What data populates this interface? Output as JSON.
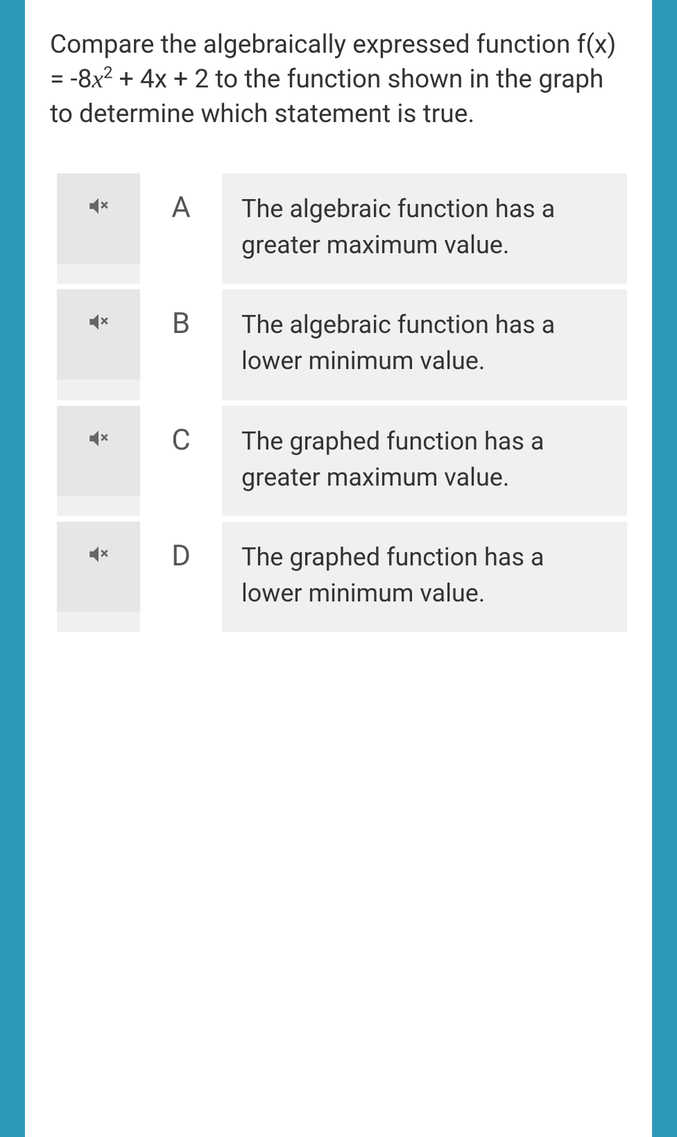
{
  "question": {
    "prefix": "Compare the algebraically expressed function f(x) = -8",
    "var": "x",
    "exp": "2",
    "suffix": " + 4x + 2 to the function shown in the graph to determine which statement is true."
  },
  "options": [
    {
      "letter": "A",
      "text": "The algebraic function has a greater maximum value."
    },
    {
      "letter": "B",
      "text": "The algebraic function has a lower minimum value."
    },
    {
      "letter": "C",
      "text": "The graphed function has a greater maximum value."
    },
    {
      "letter": "D",
      "text": "The graphed function has a lower minimum value."
    }
  ]
}
